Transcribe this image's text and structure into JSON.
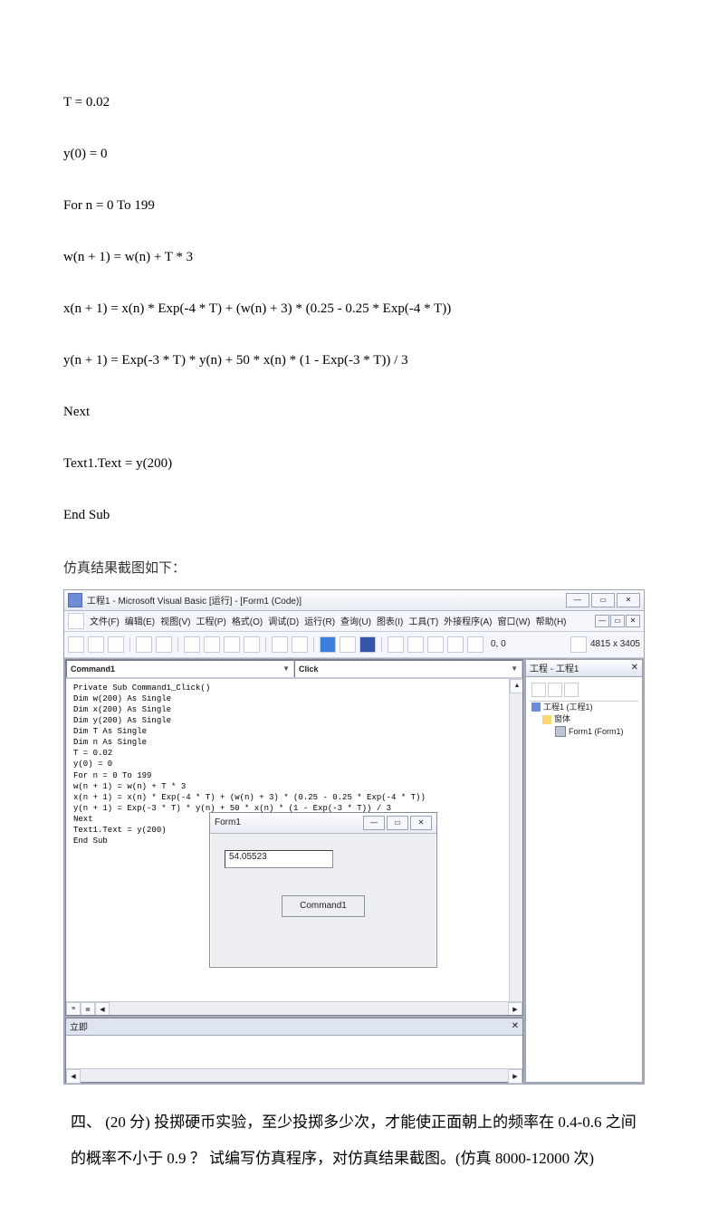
{
  "code": {
    "line1": "T = 0.02",
    "line2": "y(0) = 0",
    "line3": "For n = 0 To 199",
    "line4": "w(n + 1) = w(n) + T * 3",
    "line5": "x(n + 1) = x(n) * Exp(-4 * T) + (w(n) + 3) * (0.25 - 0.25 * Exp(-4 * T))",
    "line6": "y(n + 1) = Exp(-3 * T) * y(n) + 50 * x(n) * (1 - Exp(-3 * T)) / 3",
    "line7": "Next",
    "line8": "Text1.Text = y(200)",
    "line9": "End Sub"
  },
  "caption": "仿真结果截图如下：",
  "vb": {
    "title": "工程1 - Microsoft Visual Basic [运行] - [Form1 (Code)]",
    "menu": {
      "file": "文件(F)",
      "edit": "编辑(E)",
      "view": "视图(V)",
      "project": "工程(P)",
      "format": "格式(O)",
      "debug": "调试(D)",
      "run": "运行(R)",
      "query": "查询(U)",
      "diagram": "图表(I)",
      "tools": "工具(T)",
      "addins": "外接程序(A)",
      "window": "窗口(W)",
      "help": "帮助(H)"
    },
    "coords": "0, 0",
    "dims": "4815 x 3405",
    "dd_object": "Command1",
    "dd_proc": "Click",
    "code_text": "Private Sub Command1_Click()\nDim w(200) As Single\nDim x(200) As Single\nDim y(200) As Single\nDim T As Single\nDim n As Single\nT = 0.02\ny(0) = 0\nFor n = 0 To 199\nw(n + 1) = w(n) + T * 3\nx(n + 1) = x(n) * Exp(-4 * T) + (w(n) + 3) * (0.25 - 0.25 * Exp(-4 * T))\ny(n + 1) = Exp(-3 * T) * y(n) + 50 * x(n) * (1 - Exp(-3 * T)) / 3\nNext\nText1.Text = y(200)\nEnd Sub",
    "form": {
      "title": "Form1",
      "text_value": "54.05523",
      "button": "Command1"
    },
    "project_panel": {
      "title": "工程 - 工程1",
      "root": "工程1 (工程1)",
      "folder": "窗体",
      "form": "Form1 (Form1)"
    },
    "immediate": "立即"
  },
  "question": "四、 (20 分) 投掷硬币实验，至少投掷多少次，才能使正面朝上的频率在 0.4-0.6 之间的概率不小于 0.9 ？ 试编写仿真程序，对仿真结果截图。(仿真 8000-12000 次)"
}
